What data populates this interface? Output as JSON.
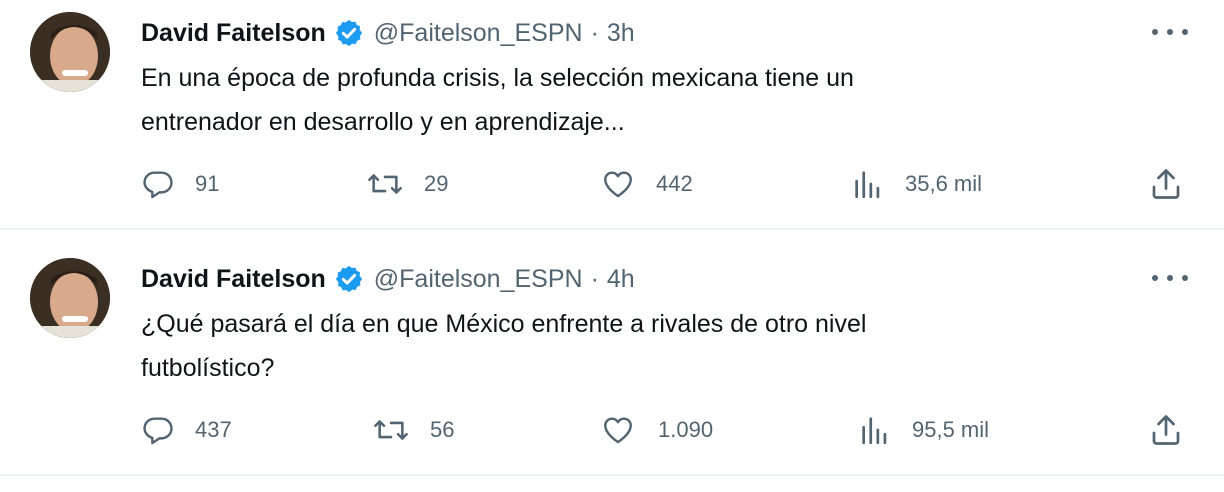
{
  "tweets": [
    {
      "author_name": "David Faitelson",
      "handle": "@Faitelson_ESPN",
      "separator": "·",
      "time": "3h",
      "text_line1": "En una época de profunda crisis, la selección mexicana tiene un",
      "text_line2": "entrenador en desarrollo y en aprendizaje...",
      "replies": "91",
      "retweets": "29",
      "likes": "442",
      "views": "35,6 mil"
    },
    {
      "author_name": "David Faitelson",
      "handle": "@Faitelson_ESPN",
      "separator": "·",
      "time": "4h",
      "text_line1": "¿Qué pasará el día en que México  enfrente a rivales de otro nivel",
      "text_line2": "futbolístico?",
      "replies": "437",
      "retweets": "56",
      "likes": "1.090",
      "views": "95,5 mil"
    }
  ],
  "colors": {
    "verified": "#1d9bf0",
    "text_primary": "#0f1419",
    "text_secondary": "#536471",
    "divider": "#eff3f4"
  },
  "icons": [
    "reply-icon",
    "retweet-icon",
    "like-icon",
    "views-icon",
    "share-icon",
    "more-icon",
    "verified-badge-icon"
  ]
}
